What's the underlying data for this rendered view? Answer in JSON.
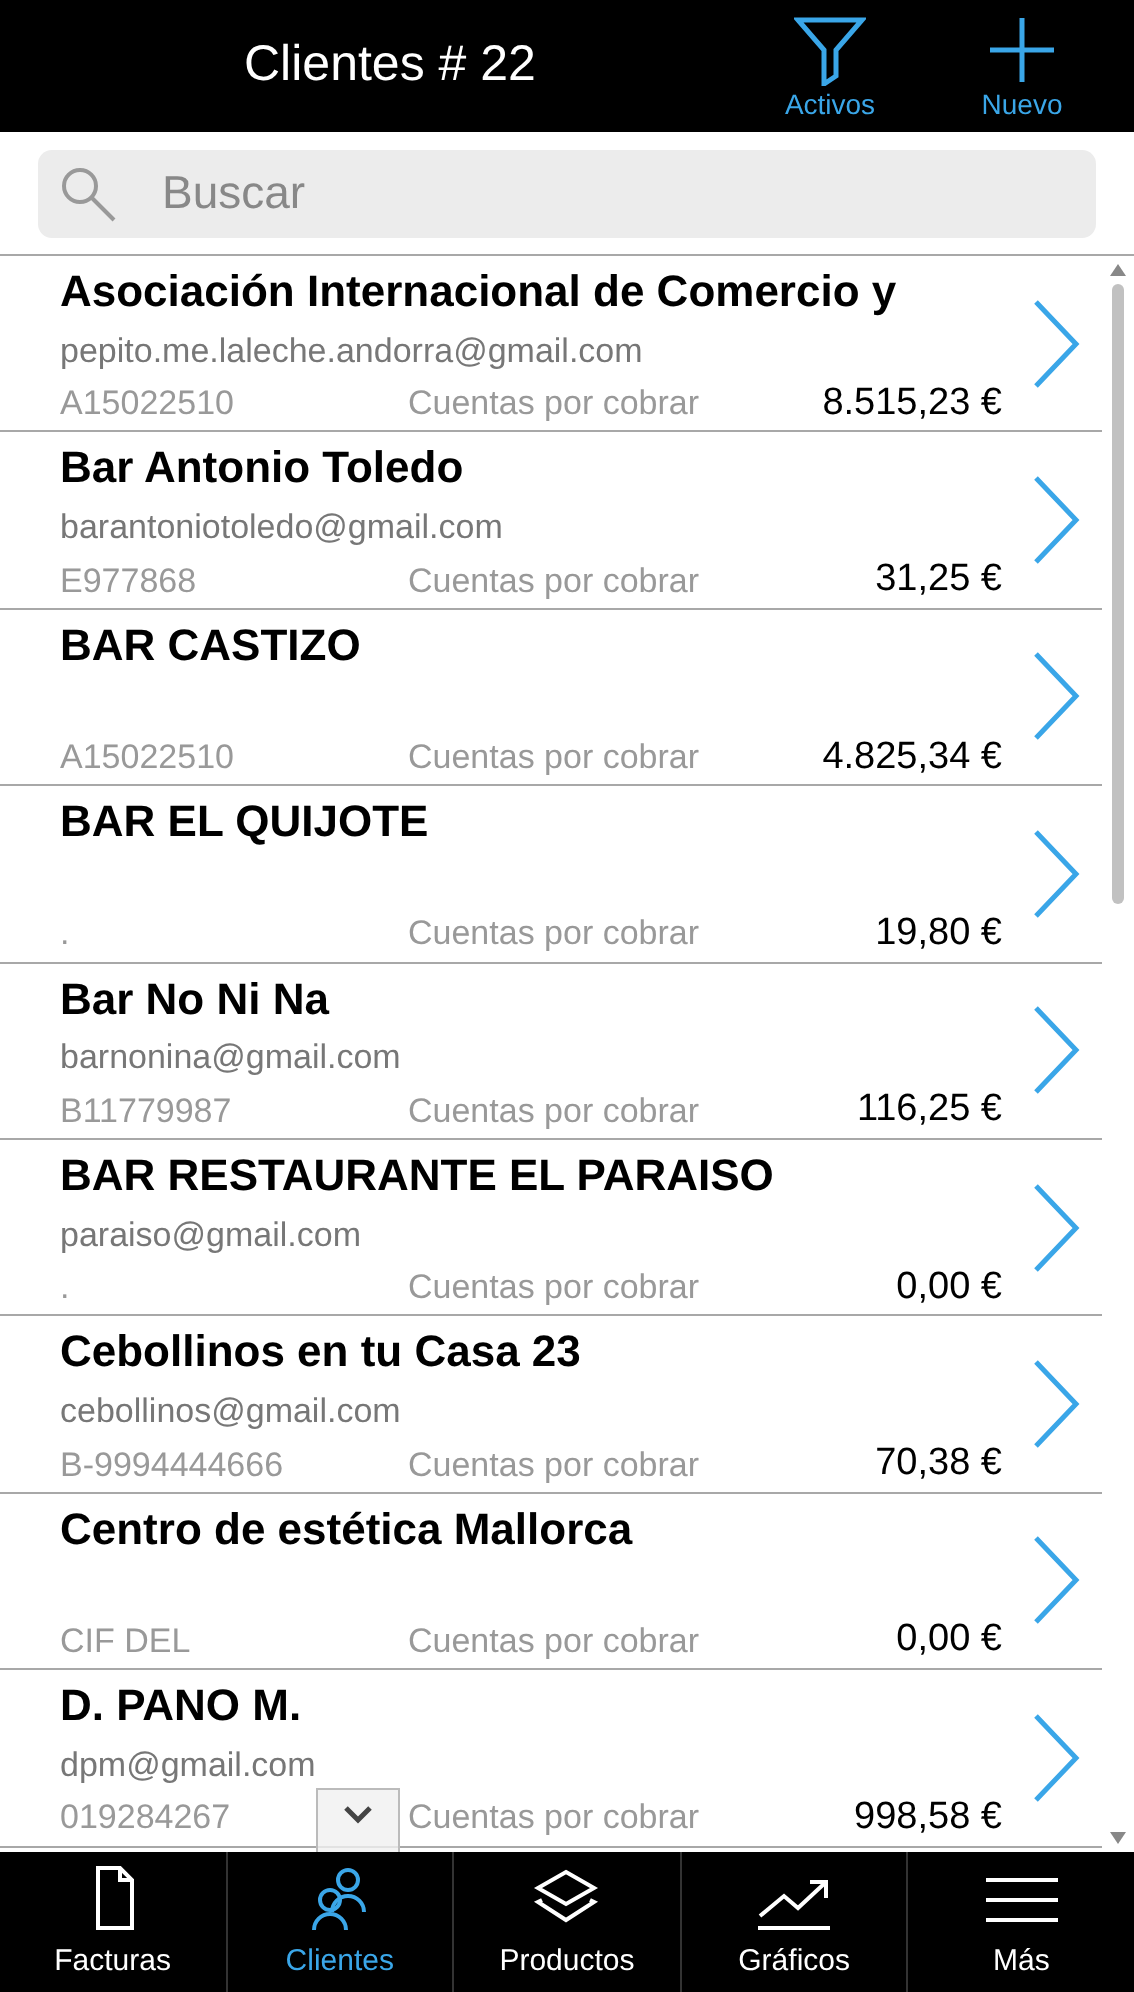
{
  "header": {
    "title": "Clientes # 22",
    "actions": [
      {
        "kind": "filter",
        "label": "Activos"
      },
      {
        "kind": "add",
        "label": "Nuevo"
      }
    ]
  },
  "search": {
    "placeholder": "Buscar"
  },
  "clients": [
    {
      "name": "Asociación Internacional de Comercio y",
      "email": "pepito.me.laleche.andorra@gmail.com",
      "id": "A15022510",
      "status": "Cuentas por cobrar",
      "amount": "8.515,23 €"
    },
    {
      "name": "Bar Antonio Toledo",
      "email": "barantoniotoledo@gmail.com",
      "id": "E977868",
      "status": "Cuentas por cobrar",
      "amount": "31,25 €"
    },
    {
      "name": "BAR CASTIZO",
      "id": "A15022510",
      "status": "Cuentas por cobrar",
      "amount": "4.825,34 €"
    },
    {
      "name": "BAR EL QUIJOTE",
      "id": ".",
      "status": "Cuentas por cobrar",
      "amount": "19,80 €"
    },
    {
      "name": "Bar No Ni Na",
      "email": "barnonina@gmail.com",
      "id": "B11779987",
      "status": "Cuentas por cobrar",
      "amount": "116,25 €"
    },
    {
      "name": "BAR RESTAURANTE EL PARAISO",
      "email": "paraiso@gmail.com",
      "id": ".",
      "status": "Cuentas por cobrar",
      "amount": "0,00 €"
    },
    {
      "name": "Cebollinos en tu Casa 23",
      "email": "cebollinos@gmail.com",
      "id": "B-9994444666",
      "status": "Cuentas por cobrar",
      "amount": "70,38 €"
    },
    {
      "name": "Centro de estética Mallorca",
      "id": "CIF DEL",
      "status": "Cuentas por cobrar",
      "amount": "0,00 €"
    },
    {
      "name": "D. PANO M.",
      "email": "dpm@gmail.com",
      "id": "019284267",
      "status": "Cuentas por cobrar",
      "amount": "998,58 €"
    }
  ],
  "nav": [
    {
      "kind": "document",
      "label": "Facturas",
      "selected": false
    },
    {
      "kind": "people",
      "label": "Clientes",
      "selected": true
    },
    {
      "kind": "layers",
      "label": "Productos",
      "selected": false
    },
    {
      "kind": "chart",
      "label": "Gráficos",
      "selected": false
    },
    {
      "kind": "menu",
      "label": "Más",
      "selected": false
    }
  ]
}
